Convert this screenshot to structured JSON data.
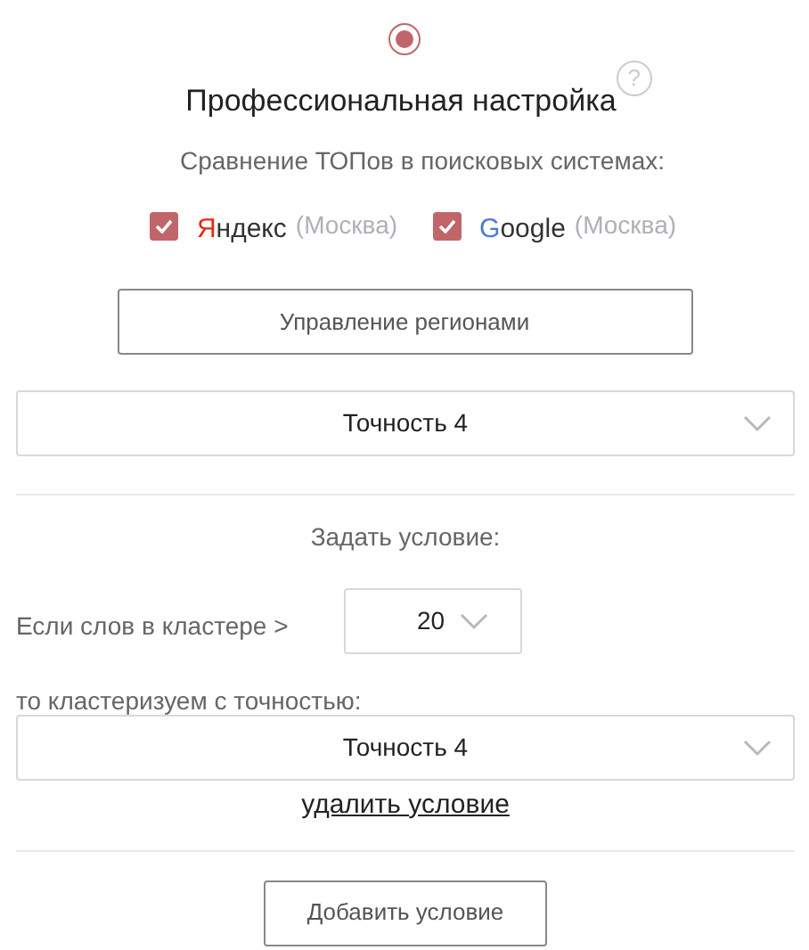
{
  "mode": {
    "selected": true,
    "title": "Профессиональная настройка",
    "help": "?"
  },
  "compare_label": "Сравнение ТОПов в поисковых системах:",
  "engines": [
    {
      "first": "Я",
      "rest": "ндекс",
      "color": "#e8270f",
      "region": "(Москва)",
      "checked": true
    },
    {
      "first": "G",
      "rest": "oogle",
      "color": "#4a7bd8",
      "region": "(Москва)",
      "checked": true
    }
  ],
  "regions_button": "Управление регионами",
  "accuracy_select": "Точность 4",
  "condition_heading": "Задать условие:",
  "condition": {
    "if_label": "Если слов в кластере >",
    "count": "20",
    "then_label": "то кластеризуем с точностью:",
    "accuracy": "Точность 4",
    "delete_link": "удалить условие"
  },
  "add_button": "Добавить условие"
}
